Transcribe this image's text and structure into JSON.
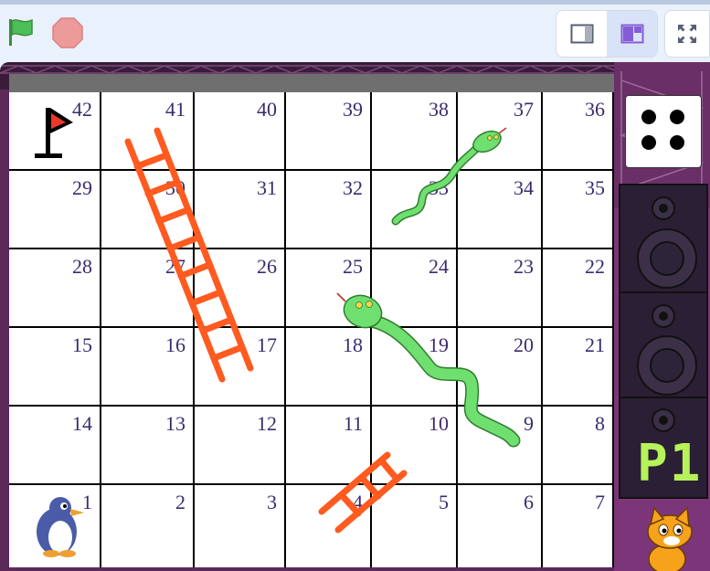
{
  "toolbar": {
    "green_flag_icon": "green-flag-icon",
    "stop_icon": "stop-sign-icon",
    "small_stage_icon": "small-stage-icon",
    "normal_stage_icon": "normal-stage-icon",
    "fullscreen_icon": "fullscreen-icon",
    "colors": {
      "flag": "#4cbf56",
      "stop": "#ec9a9a",
      "accent": "#855cd6"
    }
  },
  "board": {
    "rows": [
      [
        "42",
        "41",
        "40",
        "39",
        "38",
        "37",
        "36"
      ],
      [
        "29",
        "30",
        "31",
        "32",
        "33",
        "34",
        "35"
      ],
      [
        "28",
        "27",
        "26",
        "25",
        "24",
        "23",
        "22"
      ],
      [
        "15",
        "16",
        "17",
        "18",
        "19",
        "20",
        "21"
      ],
      [
        "14",
        "13",
        "12",
        "11",
        "10",
        "9",
        "8"
      ],
      [
        "1",
        "2",
        "3",
        "4",
        "5",
        "6",
        "7"
      ]
    ]
  },
  "die": {
    "value": 4
  },
  "player": {
    "label": "P1"
  },
  "sprites": [
    "penguin-piece",
    "cat-mascot",
    "finish-flag",
    "ladder-30-17",
    "ladder-4",
    "snake-37-33",
    "snake-25-9",
    "speaker-stack"
  ]
}
